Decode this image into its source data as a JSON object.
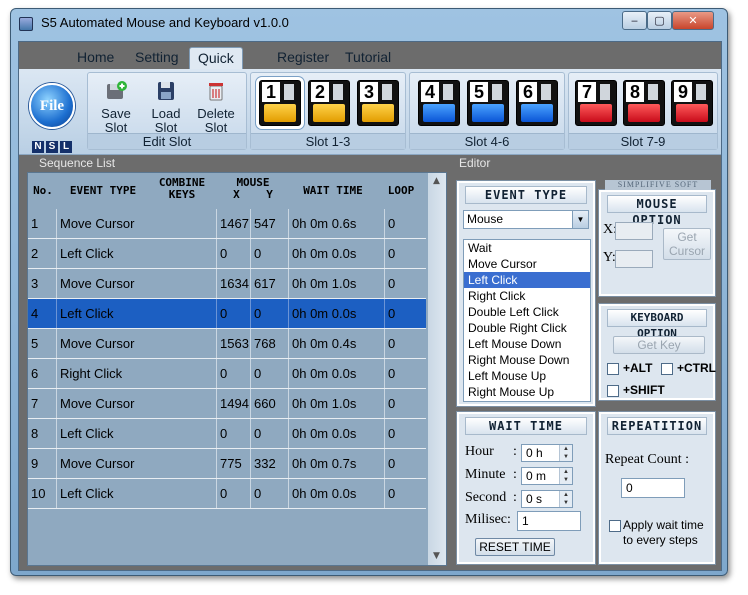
{
  "window": {
    "title": "S5 Automated Mouse and Keyboard v1.0.0",
    "min": "‒",
    "max": "▢",
    "close": "✕"
  },
  "tabs": [
    {
      "label": "Home"
    },
    {
      "label": "Setting"
    },
    {
      "label": "Quick Slot",
      "active": true
    },
    {
      "label": "Register"
    },
    {
      "label": "Tutorial"
    }
  ],
  "ribbon": {
    "file_label": "File",
    "nsl": [
      "N",
      "S",
      "L"
    ],
    "edit_slot": {
      "caption": "Edit Slot",
      "save": "Save Slot",
      "load": "Load Slot",
      "delete": "Delete Slot"
    },
    "slot_groups": [
      {
        "caption": "Slot 1-3",
        "slots": [
          "1",
          "2",
          "3"
        ],
        "color": "#f2b000"
      },
      {
        "caption": "Slot 4-6",
        "slots": [
          "4",
          "5",
          "6"
        ],
        "color": "#1a6fe6"
      },
      {
        "caption": "Slot 7-9",
        "slots": [
          "7",
          "8",
          "9"
        ],
        "color": "#e01a2a"
      }
    ]
  },
  "sequence": {
    "header": "Sequence List",
    "columns": {
      "no": "No.",
      "event": "EVENT TYPE",
      "combine1": "COMBINE",
      "combine2": "KEYS",
      "mouse": "MOUSE",
      "x": "X",
      "y": "Y",
      "wait": "WAIT TIME",
      "loop": "LOOP"
    },
    "rows": [
      {
        "no": "1",
        "event": "Move Cursor",
        "x": "1467",
        "y": "547",
        "wait": "0h 0m 0.6s",
        "loop": "0"
      },
      {
        "no": "2",
        "event": "Left Click",
        "x": "0",
        "y": "0",
        "wait": "0h 0m 0.0s",
        "loop": "0"
      },
      {
        "no": "3",
        "event": "Move Cursor",
        "x": "1634",
        "y": "617",
        "wait": "0h 0m 1.0s",
        "loop": "0"
      },
      {
        "no": "4",
        "event": "Left Click",
        "x": "0",
        "y": "0",
        "wait": "0h 0m 0.0s",
        "loop": "0",
        "selected": true
      },
      {
        "no": "5",
        "event": "Move Cursor",
        "x": "1563",
        "y": "768",
        "wait": "0h 0m 0.4s",
        "loop": "0"
      },
      {
        "no": "6",
        "event": "Right Click",
        "x": "0",
        "y": "0",
        "wait": "0h 0m 0.0s",
        "loop": "0"
      },
      {
        "no": "7",
        "event": "Move Cursor",
        "x": "1494",
        "y": "660",
        "wait": "0h 0m 1.0s",
        "loop": "0"
      },
      {
        "no": "8",
        "event": "Left Click",
        "x": "0",
        "y": "0",
        "wait": "0h 0m 0.0s",
        "loop": "0"
      },
      {
        "no": "9",
        "event": "Move Cursor",
        "x": "775",
        "y": "332",
        "wait": "0h 0m 0.7s",
        "loop": "0"
      },
      {
        "no": "10",
        "event": "Left Click",
        "x": "0",
        "y": "0",
        "wait": "0h 0m 0.0s",
        "loop": "0"
      }
    ]
  },
  "editor": {
    "header": "Editor",
    "event_type": {
      "title": "EVENT TYPE",
      "selected": "Mouse",
      "options": [
        "Wait",
        "Move Cursor",
        "Left Click",
        "Right Click",
        "Double Left Click",
        "Double Right Click",
        "Left Mouse Down",
        "Right Mouse Down",
        "Left Mouse Up",
        "Right Mouse Up"
      ],
      "selected_option": "Left Click"
    },
    "brand": "SIMPLIFIVE SOFT",
    "mouse_option": {
      "title": "MOUSE OPTION",
      "x_label": "X:",
      "y_label": "Y:",
      "get_cursor": "Get Cursor"
    },
    "keyboard_option": {
      "title": "KEYBOARD OPTION",
      "get_key": "Get Key",
      "alt": "+ALT",
      "ctrl": "+CTRL",
      "shift": "+SHIFT"
    },
    "wait_time": {
      "title": "WAIT TIME",
      "hour_label": "Hour",
      "hour_value": "0 h",
      "minute_label": "Minute",
      "minute_value": "0 m",
      "second_label": "Second",
      "second_value": "0 s",
      "milisec_label": "Milisec:",
      "milisec_value": "1",
      "colon": ":",
      "reset": "RESET TIME"
    },
    "repetition": {
      "title": "REPEATITION",
      "repeat_label": "Repeat Count :",
      "repeat_value": "0",
      "apply_label": "Apply wait time to every steps"
    }
  }
}
